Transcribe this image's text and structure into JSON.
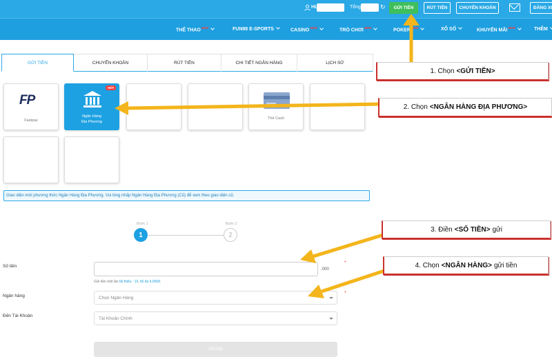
{
  "header": {
    "user_prefix": "HL",
    "total_label": "Tổng:",
    "refresh_icon": "refresh-icon",
    "deposit_label": "GỬI TIỀN",
    "withdraw_label": "RÚT TIỀN",
    "transfer_label": "CHUYỂN KHOẢN",
    "mail_icon": "mail-icon",
    "login_label": "ĐĂNG XU"
  },
  "nav": {
    "new_badge": "NEW",
    "items": [
      {
        "label": "THỂ THAO"
      },
      {
        "label": "FUN88 E-SPORTS"
      },
      {
        "label": "CASINO"
      },
      {
        "label": "TRÒ CHƠI"
      },
      {
        "label": "POKER"
      },
      {
        "label": "XỔ SỐ"
      },
      {
        "label": "KHUYẾN MÃI"
      },
      {
        "label": "THÊM"
      }
    ]
  },
  "tabs": [
    {
      "label": "GỬI TIỀN",
      "active": true
    },
    {
      "label": "CHUYỂN KHOẢN",
      "active": false
    },
    {
      "label": "RÚT TIỀN",
      "active": false
    },
    {
      "label": "CHI TIẾT NGÂN HÀNG",
      "active": false
    },
    {
      "label": "LỊCH SỬ",
      "active": false
    }
  ],
  "methods": {
    "fastpay_logo": "FP",
    "fastpay_label": "Fastpay",
    "local_bank_badge": "MỚI",
    "local_bank_line1": "Ngân Hàng",
    "local_bank_line2": "Địa Phương",
    "the_cash_label": "Thẻ Cash"
  },
  "info_text": "Giao diện mới phương thức Ngân Hàng Địa Phương. Vui lòng nhấp Ngân Hàng Địa Phương (Cũ) để xem theo giao diện cũ.",
  "steps": [
    {
      "label": "Bước 1",
      "number": "1"
    },
    {
      "label": "Bước 2",
      "number": "2"
    }
  ],
  "form": {
    "amount_label": "Số tiền",
    "amount_value": "",
    "amount_suffix": ",000",
    "required_mark": "*",
    "hint_prefix": "Gửi tiền một lần",
    "hint_min": "tối thiểu : 10",
    "hint_max": ", tối đa 6,000đ.",
    "bank_label": "Ngân hàng",
    "bank_placeholder": "Chọn Ngân Hàng",
    "account_label": "Đến Tài Khoản",
    "account_value": "Tài Khoản Chính",
    "submit_label": "Gửi tiếp"
  },
  "callouts": {
    "c1_prefix": "1. Chọn",
    "c1_bold": "<GỬI TIỀN>",
    "c2_prefix": "2. Chọn",
    "c2_bold": "<NGÂN HÀNG ĐỊA PHƯƠNG>",
    "c3_prefix": "3. Điền",
    "c3_bold": "<SỐ TIỀN>",
    "c3_suffix": "gửi",
    "c4_prefix": "4. Chọn",
    "c4_bold": "<NGÂN HÀNG>",
    "c4_suffix": "gửi tiền"
  },
  "colors": {
    "header_blue": "#2aa9e6",
    "nav_blue": "#1d9fe0",
    "deposit_green": "#3fbf5b",
    "arrow_yellow": "#f3b51b",
    "callout_red": "#c9302c"
  }
}
